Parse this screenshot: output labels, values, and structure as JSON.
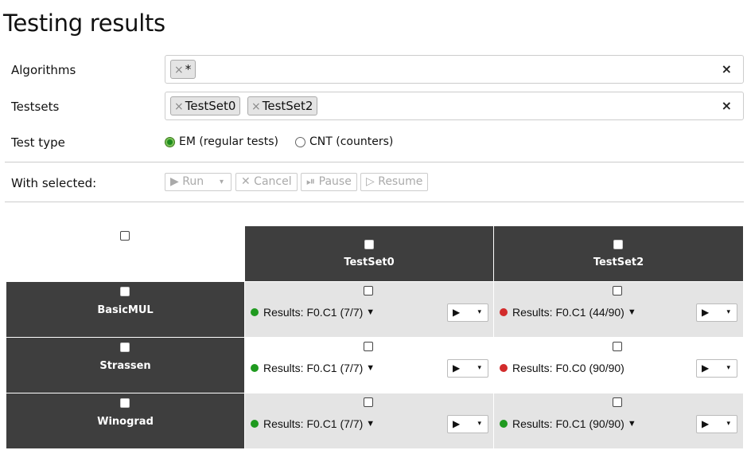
{
  "page_title": "Testing results",
  "filters": {
    "algorithms_label": "Algorithms",
    "algorithms_tags": [
      "*"
    ],
    "testsets_label": "Testsets",
    "testsets_tags": [
      "TestSet0",
      "TestSet2"
    ],
    "clear_symbol": "×",
    "tag_remove_symbol": "×",
    "test_type_label": "Test type",
    "test_type_options": [
      {
        "label": "EM (regular tests)",
        "selected": true
      },
      {
        "label": "CNT (counters)",
        "selected": false
      }
    ]
  },
  "actions": {
    "with_selected_label": "With selected:",
    "run": "▶ Run",
    "run_caret": "▾",
    "cancel": "✕ Cancel",
    "pause": "⏯ Pause",
    "resume": "▷ Resume"
  },
  "grid": {
    "columns": [
      "TestSet0",
      "TestSet2"
    ],
    "rows": [
      {
        "name": "BasicMUL",
        "cells": [
          {
            "status": "green",
            "text": "Results: F0.C1 (7/7)",
            "has_dropdown": true
          },
          {
            "status": "red",
            "text": "Results: F0.C1 (44/90)",
            "has_dropdown": true
          }
        ]
      },
      {
        "name": "Strassen",
        "cells": [
          {
            "status": "green",
            "text": "Results: F0.C1 (7/7)",
            "has_dropdown": true
          },
          {
            "status": "red",
            "text": "Results: F0.C0 (90/90)",
            "has_dropdown": false
          }
        ]
      },
      {
        "name": "Winograd",
        "cells": [
          {
            "status": "green",
            "text": "Results: F0.C1 (7/7)",
            "has_dropdown": true
          },
          {
            "status": "green",
            "text": "Results: F0.C1 (90/90)",
            "has_dropdown": true
          }
        ]
      }
    ],
    "run_button_icon": "▶",
    "run_button_caret": "▾",
    "dropdown_caret": "▼"
  },
  "colors": {
    "header_bg": "#3e3e3e",
    "status_green": "#1f9a1f",
    "status_red": "#d22b2b",
    "row_alt_bg": "#e4e4e4"
  }
}
